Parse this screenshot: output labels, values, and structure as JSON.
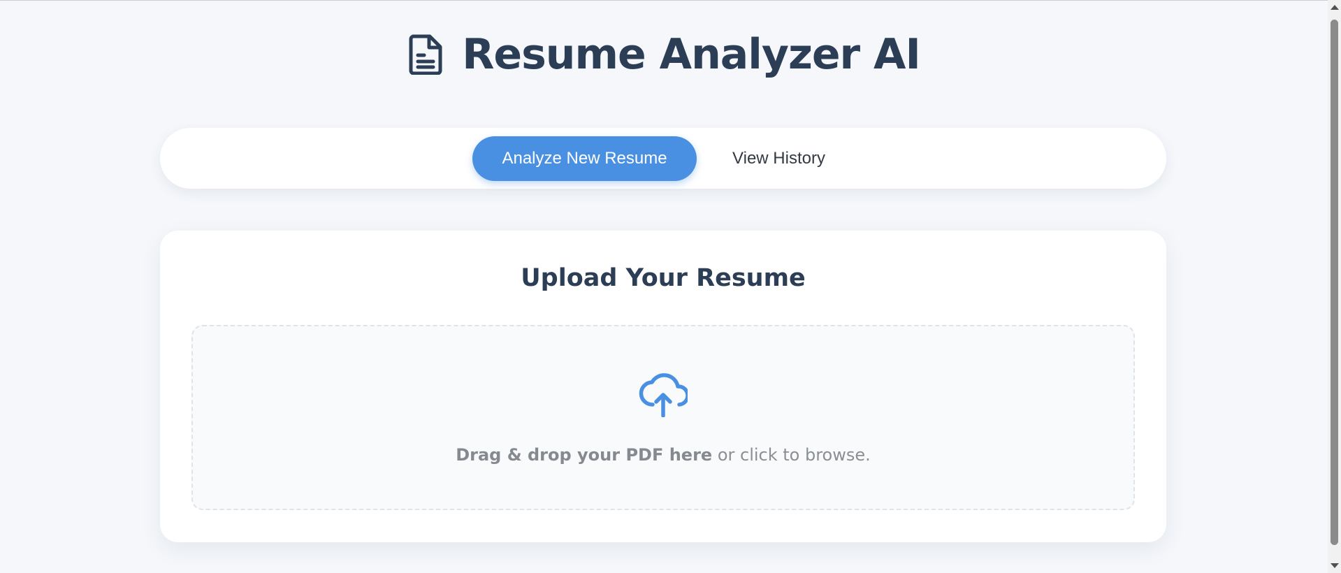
{
  "header": {
    "icon": "file-text-icon",
    "title": "Resume Analyzer AI"
  },
  "tabs": [
    {
      "label": "Analyze New Resume",
      "active": true
    },
    {
      "label": "View History",
      "active": false
    }
  ],
  "upload_card": {
    "title": "Upload Your Resume",
    "dropzone": {
      "icon": "cloud-upload-icon",
      "bold_text": "Drag & drop your PDF here",
      "rest_text": " or click to browse."
    }
  },
  "colors": {
    "accent": "#4a90e2",
    "title": "#2c3e55",
    "background": "#f5f7fb",
    "card": "#ffffff",
    "muted_text": "#8a8f96"
  }
}
